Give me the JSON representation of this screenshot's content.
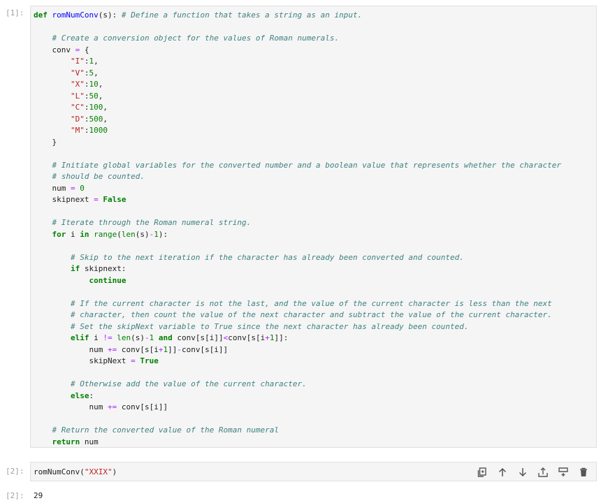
{
  "cells": [
    {
      "prompt": "[1]:",
      "lines": [
        [
          [
            "kw",
            "def"
          ],
          [
            "t",
            " "
          ],
          [
            "fn",
            "romNumConv"
          ],
          [
            "t",
            "(s): "
          ],
          [
            "cm",
            "# Define a function that takes a string as an input."
          ]
        ],
        [],
        [
          [
            "t",
            "    "
          ],
          [
            "cm",
            "# Create a conversion object for the values of Roman numerals."
          ]
        ],
        [
          [
            "t",
            "    conv "
          ],
          [
            "op",
            "="
          ],
          [
            "t",
            " {"
          ]
        ],
        [
          [
            "t",
            "        "
          ],
          [
            "st",
            "\"I\""
          ],
          [
            "t",
            ":"
          ],
          [
            "nm",
            "1"
          ],
          [
            "t",
            ","
          ]
        ],
        [
          [
            "t",
            "        "
          ],
          [
            "st",
            "\"V\""
          ],
          [
            "t",
            ":"
          ],
          [
            "nm",
            "5"
          ],
          [
            "t",
            ","
          ]
        ],
        [
          [
            "t",
            "        "
          ],
          [
            "st",
            "\"X\""
          ],
          [
            "t",
            ":"
          ],
          [
            "nm",
            "10"
          ],
          [
            "t",
            ","
          ]
        ],
        [
          [
            "t",
            "        "
          ],
          [
            "st",
            "\"L\""
          ],
          [
            "t",
            ":"
          ],
          [
            "nm",
            "50"
          ],
          [
            "t",
            ","
          ]
        ],
        [
          [
            "t",
            "        "
          ],
          [
            "st",
            "\"C\""
          ],
          [
            "t",
            ":"
          ],
          [
            "nm",
            "100"
          ],
          [
            "t",
            ","
          ]
        ],
        [
          [
            "t",
            "        "
          ],
          [
            "st",
            "\"D\""
          ],
          [
            "t",
            ":"
          ],
          [
            "nm",
            "500"
          ],
          [
            "t",
            ","
          ]
        ],
        [
          [
            "t",
            "        "
          ],
          [
            "st",
            "\"M\""
          ],
          [
            "t",
            ":"
          ],
          [
            "nm",
            "1000"
          ]
        ],
        [
          [
            "t",
            "    }"
          ]
        ],
        [],
        [
          [
            "t",
            "    "
          ],
          [
            "cm",
            "# Initiate global variables for the converted number and a boolean value that represents whether the character"
          ]
        ],
        [
          [
            "t",
            "    "
          ],
          [
            "cm",
            "# should be counted."
          ]
        ],
        [
          [
            "t",
            "    num "
          ],
          [
            "op",
            "="
          ],
          [
            "t",
            " "
          ],
          [
            "nm",
            "0"
          ]
        ],
        [
          [
            "t",
            "    skipnext "
          ],
          [
            "op",
            "="
          ],
          [
            "t",
            " "
          ],
          [
            "kw",
            "False"
          ]
        ],
        [],
        [
          [
            "t",
            "    "
          ],
          [
            "cm",
            "# Iterate through the Roman numeral string."
          ]
        ],
        [
          [
            "t",
            "    "
          ],
          [
            "kw",
            "for"
          ],
          [
            "t",
            " i "
          ],
          [
            "kw",
            "in"
          ],
          [
            "t",
            " "
          ],
          [
            "nm",
            "range"
          ],
          [
            "t",
            "("
          ],
          [
            "nm",
            "len"
          ],
          [
            "t",
            "(s)"
          ],
          [
            "op",
            "-"
          ],
          [
            "nm",
            "1"
          ],
          [
            "t",
            "):"
          ]
        ],
        [],
        [
          [
            "t",
            "        "
          ],
          [
            "cm",
            "# Skip to the next iteration if the character has already been converted and counted."
          ]
        ],
        [
          [
            "t",
            "        "
          ],
          [
            "kw",
            "if"
          ],
          [
            "t",
            " skipnext:"
          ]
        ],
        [
          [
            "t",
            "            "
          ],
          [
            "kw",
            "continue"
          ]
        ],
        [],
        [
          [
            "t",
            "        "
          ],
          [
            "cm",
            "# If the current character is not the last, and the value of the current character is less than the next"
          ]
        ],
        [
          [
            "t",
            "        "
          ],
          [
            "cm",
            "# character, then count the value of the next character and subtract the value of the current character."
          ]
        ],
        [
          [
            "t",
            "        "
          ],
          [
            "cm",
            "# Set the skipNext variable to True since the next character has already been counted."
          ]
        ],
        [
          [
            "t",
            "        "
          ],
          [
            "kw",
            "elif"
          ],
          [
            "t",
            " i "
          ],
          [
            "op",
            "!="
          ],
          [
            "t",
            " "
          ],
          [
            "nm",
            "len"
          ],
          [
            "t",
            "(s)"
          ],
          [
            "op",
            "-"
          ],
          [
            "nm",
            "1"
          ],
          [
            "t",
            " "
          ],
          [
            "kw",
            "and"
          ],
          [
            "t",
            " conv[s[i]]"
          ],
          [
            "op",
            "<"
          ],
          [
            "t",
            "conv[s[i"
          ],
          [
            "op",
            "+"
          ],
          [
            "nm",
            "1"
          ],
          [
            "t",
            "]]:"
          ]
        ],
        [
          [
            "t",
            "            num "
          ],
          [
            "op",
            "+="
          ],
          [
            "t",
            " conv[s[i"
          ],
          [
            "op",
            "+"
          ],
          [
            "nm",
            "1"
          ],
          [
            "t",
            "]]"
          ],
          [
            "op",
            "-"
          ],
          [
            "t",
            "conv[s[i]]"
          ]
        ],
        [
          [
            "t",
            "            skipNext "
          ],
          [
            "op",
            "="
          ],
          [
            "t",
            " "
          ],
          [
            "kw",
            "True"
          ]
        ],
        [],
        [
          [
            "t",
            "        "
          ],
          [
            "cm",
            "# Otherwise add the value of the current character."
          ]
        ],
        [
          [
            "t",
            "        "
          ],
          [
            "kw",
            "else"
          ],
          [
            "t",
            ":"
          ]
        ],
        [
          [
            "t",
            "            num "
          ],
          [
            "op",
            "+="
          ],
          [
            "t",
            " conv[s[i]]"
          ]
        ],
        [],
        [
          [
            "t",
            "    "
          ],
          [
            "cm",
            "# Return the converted value of the Roman numeral"
          ]
        ],
        [
          [
            "t",
            "    "
          ],
          [
            "kw",
            "return"
          ],
          [
            "t",
            " num"
          ]
        ]
      ]
    },
    {
      "prompt": "[2]:",
      "lines": [
        [
          [
            "t",
            "romNumConv("
          ],
          [
            "st",
            "\"XXIX\""
          ],
          [
            "t",
            ")"
          ]
        ]
      ]
    }
  ],
  "output": {
    "prompt": "[2]:",
    "value": "29"
  },
  "toolbar": [
    "duplicate-icon",
    "move-up-icon",
    "move-down-icon",
    "insert-above-icon",
    "insert-below-icon",
    "delete-icon"
  ]
}
